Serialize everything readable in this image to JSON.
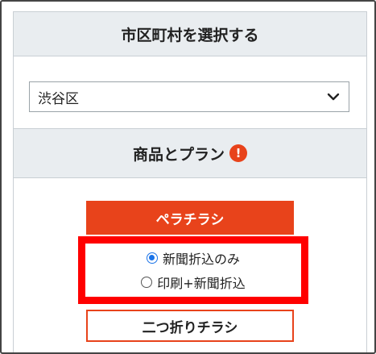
{
  "municipality": {
    "heading": "市区町村を選択する",
    "selected_value": "渋谷区"
  },
  "products": {
    "heading": "商品とプラン",
    "alert_icon": "!",
    "buttons": {
      "flyer_flat": "ペラチラシ",
      "flyer_folded": "二つ折りチラシ"
    },
    "options": [
      {
        "label": "新聞折込のみ",
        "checked": true
      },
      {
        "label": "印刷+新聞折込",
        "checked": false
      }
    ]
  },
  "colors": {
    "accent": "#e8431b",
    "highlight": "#ff0000",
    "radio_checked": "#1a73e8",
    "section_bg": "#e9edf0"
  }
}
